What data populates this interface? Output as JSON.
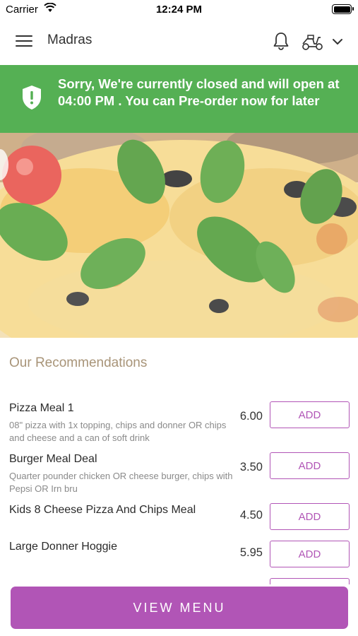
{
  "status_bar": {
    "carrier": "Carrier",
    "time": "12:24 PM"
  },
  "header": {
    "title": "Madras",
    "icons": [
      "menu-icon",
      "bell-icon",
      "scooter-icon",
      "chevron-down-icon"
    ]
  },
  "banner": {
    "message": "Sorry, We're currently closed and will open at 04:00 PM . You can Pre-order now for later",
    "color": "#55b054",
    "icon": "shield-icon"
  },
  "hero": {
    "image": "pizza-image"
  },
  "recommendations": {
    "title": "Our Recommendations",
    "items": [
      {
        "name": "Pizza Meal 1",
        "description": "08\" pizza with 1x topping, chips and donner OR chips and cheese and a can of soft drink",
        "price": "6.00",
        "button": "ADD"
      },
      {
        "name": "Burger Meal Deal",
        "description": "Quarter pounder chicken OR cheese burger, chips with Pepsi OR Irn bru",
        "price": "3.50",
        "button": "ADD"
      },
      {
        "name": "Kids 8 Cheese Pizza And Chips Meal",
        "description": "",
        "price": "4.50",
        "button": "ADD"
      },
      {
        "name": "Large Donner Hoggie",
        "description": "",
        "price": "5.95",
        "button": "ADD"
      }
    ]
  },
  "footer": {
    "view_menu_label": "VIEW MENU",
    "accent_color": "#b155b6"
  }
}
